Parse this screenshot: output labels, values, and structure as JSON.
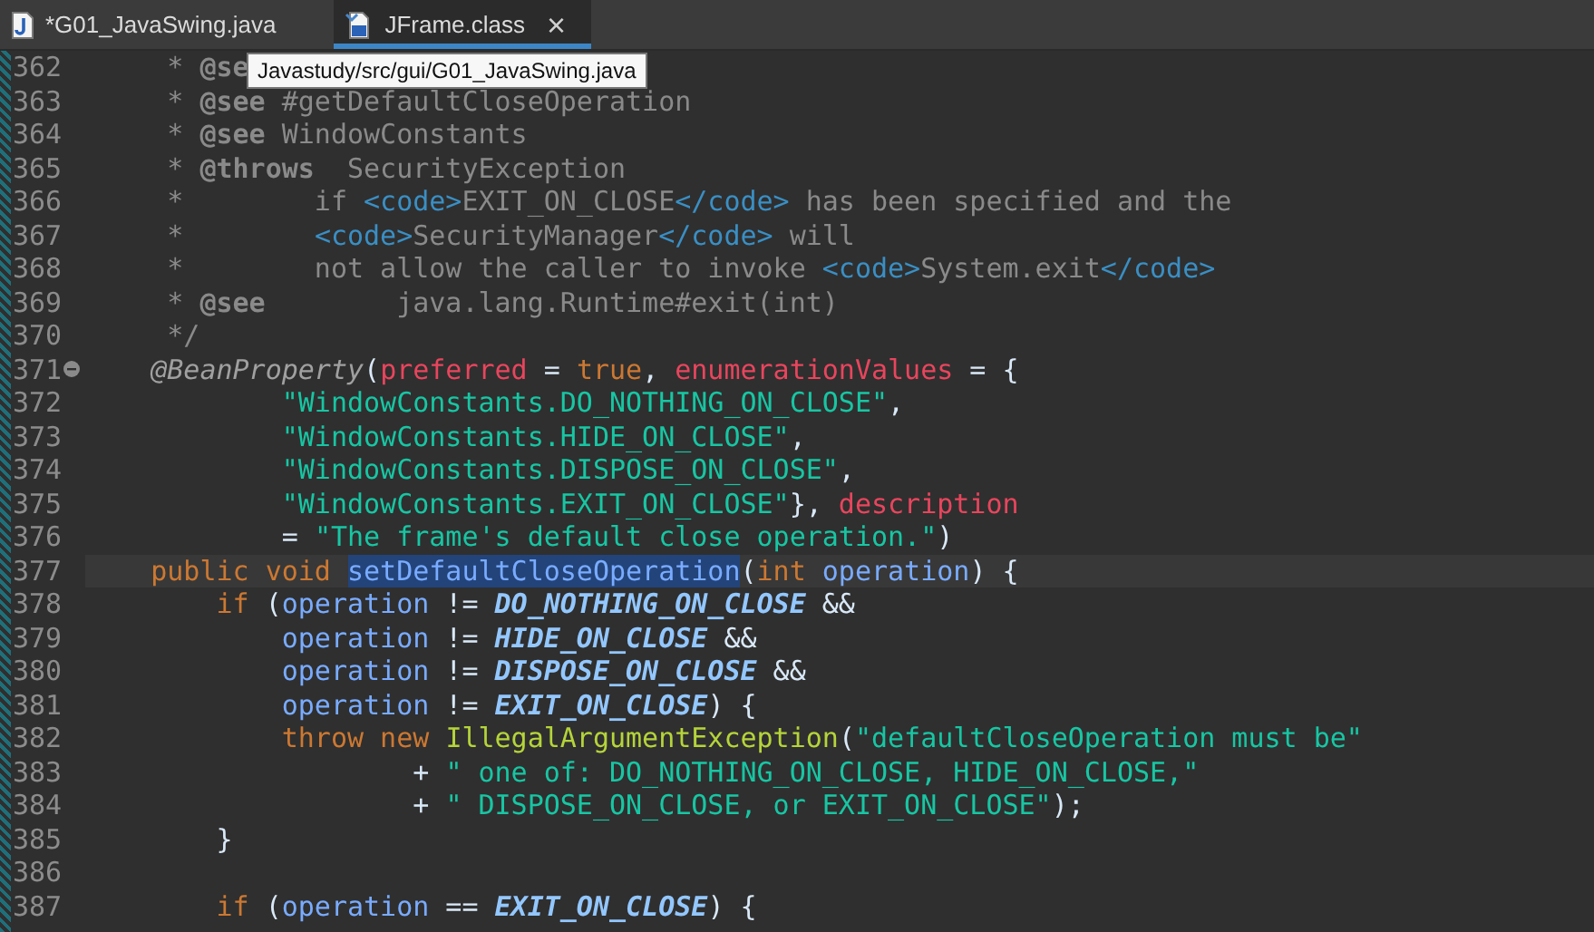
{
  "tabs": [
    {
      "label": "*G01_JavaSwing.java",
      "kind": "java",
      "selected": false,
      "closable": false
    },
    {
      "label": "JFrame.class",
      "kind": "class",
      "selected": true,
      "closable": true
    }
  ],
  "close_glyph": "×",
  "tooltip": "Javastudy/src/gui/G01_JavaSwing.java",
  "lines": [
    {
      "number": "362",
      "current": false,
      "collapsible": false,
      "tokens": [
        {
          "kind": "comment",
          "text": "     * "
        },
        {
          "kind": "doctag",
          "text": "@se"
        }
      ]
    },
    {
      "number": "363",
      "current": false,
      "collapsible": false,
      "tokens": [
        {
          "kind": "comment",
          "text": "     * "
        },
        {
          "kind": "doctag",
          "text": "@see"
        },
        {
          "kind": "comment",
          "text": " #getDefaultCloseOperation"
        }
      ]
    },
    {
      "number": "364",
      "current": false,
      "collapsible": false,
      "tokens": [
        {
          "kind": "comment",
          "text": "     * "
        },
        {
          "kind": "doctag",
          "text": "@see"
        },
        {
          "kind": "comment",
          "text": " WindowConstants"
        }
      ]
    },
    {
      "number": "365",
      "current": false,
      "collapsible": false,
      "tokens": [
        {
          "kind": "comment",
          "text": "     * "
        },
        {
          "kind": "doctag",
          "text": "@throws"
        },
        {
          "kind": "comment",
          "text": "  SecurityException"
        }
      ]
    },
    {
      "number": "366",
      "current": false,
      "collapsible": false,
      "tokens": [
        {
          "kind": "comment",
          "text": "     *        if "
        },
        {
          "kind": "html",
          "text": "<code>"
        },
        {
          "kind": "comment",
          "text": "EXIT_ON_CLOSE"
        },
        {
          "kind": "html",
          "text": "</code>"
        },
        {
          "kind": "comment",
          "text": " has been specified and the"
        }
      ]
    },
    {
      "number": "367",
      "current": false,
      "collapsible": false,
      "tokens": [
        {
          "kind": "comment",
          "text": "     *        "
        },
        {
          "kind": "html",
          "text": "<code>"
        },
        {
          "kind": "comment",
          "text": "SecurityManager"
        },
        {
          "kind": "html",
          "text": "</code>"
        },
        {
          "kind": "comment",
          "text": " will"
        }
      ]
    },
    {
      "number": "368",
      "current": false,
      "collapsible": false,
      "tokens": [
        {
          "kind": "comment",
          "text": "     *        not allow the caller to invoke "
        },
        {
          "kind": "html",
          "text": "<code>"
        },
        {
          "kind": "comment",
          "text": "System.exit"
        },
        {
          "kind": "html",
          "text": "</code>"
        }
      ]
    },
    {
      "number": "369",
      "current": false,
      "collapsible": false,
      "tokens": [
        {
          "kind": "comment",
          "text": "     * "
        },
        {
          "kind": "doctag",
          "text": "@see"
        },
        {
          "kind": "comment",
          "text": "        java.lang.Runtime#exit(int)"
        }
      ]
    },
    {
      "number": "370",
      "current": false,
      "collapsible": false,
      "tokens": [
        {
          "kind": "comment",
          "text": "     */"
        }
      ]
    },
    {
      "number": "371",
      "current": false,
      "collapsible": true,
      "tokens": [
        {
          "kind": "annotation",
          "text": "    @BeanProperty"
        },
        {
          "kind": "plain",
          "text": "("
        },
        {
          "kind": "attr",
          "text": "preferred"
        },
        {
          "kind": "plain",
          "text": " = "
        },
        {
          "kind": "keyword",
          "text": "true"
        },
        {
          "kind": "plain",
          "text": ", "
        },
        {
          "kind": "attr",
          "text": "enumerationValues"
        },
        {
          "kind": "plain",
          "text": " = {"
        }
      ]
    },
    {
      "number": "372",
      "current": false,
      "collapsible": false,
      "tokens": [
        {
          "kind": "string",
          "text": "            \"WindowConstants.DO_NOTHING_ON_CLOSE\""
        },
        {
          "kind": "plain",
          "text": ","
        }
      ]
    },
    {
      "number": "373",
      "current": false,
      "collapsible": false,
      "tokens": [
        {
          "kind": "string",
          "text": "            \"WindowConstants.HIDE_ON_CLOSE\""
        },
        {
          "kind": "plain",
          "text": ","
        }
      ]
    },
    {
      "number": "374",
      "current": false,
      "collapsible": false,
      "tokens": [
        {
          "kind": "string",
          "text": "            \"WindowConstants.DISPOSE_ON_CLOSE\""
        },
        {
          "kind": "plain",
          "text": ","
        }
      ]
    },
    {
      "number": "375",
      "current": false,
      "collapsible": false,
      "tokens": [
        {
          "kind": "string",
          "text": "            \"WindowConstants.EXIT_ON_CLOSE\""
        },
        {
          "kind": "plain",
          "text": "}, "
        },
        {
          "kind": "attr",
          "text": "description"
        }
      ]
    },
    {
      "number": "376",
      "current": false,
      "collapsible": false,
      "tokens": [
        {
          "kind": "plain",
          "text": "            = "
        },
        {
          "kind": "string",
          "text": "\"The frame's default close operation.\""
        },
        {
          "kind": "plain",
          "text": ")"
        }
      ]
    },
    {
      "number": "377",
      "current": true,
      "collapsible": false,
      "tokens": [
        {
          "kind": "keyword",
          "text": "    public void "
        },
        {
          "kind": "selection",
          "text": "setDefaultCloseOperation"
        },
        {
          "kind": "plain",
          "text": "("
        },
        {
          "kind": "keyword",
          "text": "int "
        },
        {
          "kind": "param",
          "text": "operation"
        },
        {
          "kind": "plain",
          "text": ") {"
        }
      ]
    },
    {
      "number": "378",
      "current": false,
      "collapsible": false,
      "tokens": [
        {
          "kind": "keyword",
          "text": "        if "
        },
        {
          "kind": "plain",
          "text": "("
        },
        {
          "kind": "param",
          "text": "operation"
        },
        {
          "kind": "plain",
          "text": " != "
        },
        {
          "kind": "constant",
          "text": "DO_NOTHING_ON_CLOSE"
        },
        {
          "kind": "plain",
          "text": " &&"
        }
      ]
    },
    {
      "number": "379",
      "current": false,
      "collapsible": false,
      "tokens": [
        {
          "kind": "param",
          "text": "            operation"
        },
        {
          "kind": "plain",
          "text": " != "
        },
        {
          "kind": "constant",
          "text": "HIDE_ON_CLOSE"
        },
        {
          "kind": "plain",
          "text": " &&"
        }
      ]
    },
    {
      "number": "380",
      "current": false,
      "collapsible": false,
      "tokens": [
        {
          "kind": "param",
          "text": "            operation"
        },
        {
          "kind": "plain",
          "text": " != "
        },
        {
          "kind": "constant",
          "text": "DISPOSE_ON_CLOSE"
        },
        {
          "kind": "plain",
          "text": " &&"
        }
      ]
    },
    {
      "number": "381",
      "current": false,
      "collapsible": false,
      "tokens": [
        {
          "kind": "param",
          "text": "            operation"
        },
        {
          "kind": "plain",
          "text": " != "
        },
        {
          "kind": "constant",
          "text": "EXIT_ON_CLOSE"
        },
        {
          "kind": "plain",
          "text": ") {"
        }
      ]
    },
    {
      "number": "382",
      "current": false,
      "collapsible": false,
      "tokens": [
        {
          "kind": "keyword",
          "text": "            throw new "
        },
        {
          "kind": "type",
          "text": "IllegalArgumentException"
        },
        {
          "kind": "plain",
          "text": "("
        },
        {
          "kind": "string",
          "text": "\"defaultCloseOperation must be\""
        }
      ]
    },
    {
      "number": "383",
      "current": false,
      "collapsible": false,
      "tokens": [
        {
          "kind": "plain",
          "text": "                    + "
        },
        {
          "kind": "string",
          "text": "\" one of: DO_NOTHING_ON_CLOSE, HIDE_ON_CLOSE,\""
        }
      ]
    },
    {
      "number": "384",
      "current": false,
      "collapsible": false,
      "tokens": [
        {
          "kind": "plain",
          "text": "                    + "
        },
        {
          "kind": "string",
          "text": "\" DISPOSE_ON_CLOSE, or EXIT_ON_CLOSE\""
        },
        {
          "kind": "plain",
          "text": ");"
        }
      ]
    },
    {
      "number": "385",
      "current": false,
      "collapsible": false,
      "tokens": [
        {
          "kind": "plain",
          "text": "        }"
        }
      ]
    },
    {
      "number": "386",
      "current": false,
      "collapsible": false
    },
    {
      "number": "387",
      "current": false,
      "collapsible": false,
      "tokens": [
        {
          "kind": "keyword",
          "text": "        if "
        },
        {
          "kind": "plain",
          "text": "("
        },
        {
          "kind": "param",
          "text": "operation"
        },
        {
          "kind": "plain",
          "text": " == "
        },
        {
          "kind": "constant",
          "text": "EXIT_ON_CLOSE"
        },
        {
          "kind": "plain",
          "text": ") {"
        }
      ]
    }
  ]
}
